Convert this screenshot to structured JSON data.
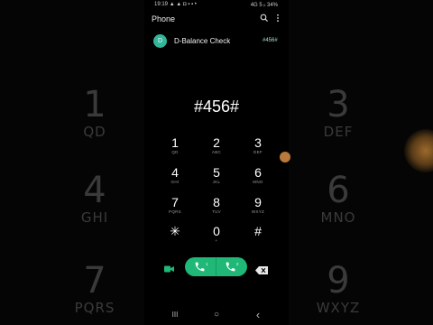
{
  "status_bar": {
    "time": "19:19",
    "left_icons": "▲ ▲ ◘ ▪ ▪ •",
    "right_info": "4G 5 ᵢₗ 34%"
  },
  "app_bar": {
    "title": "Phone",
    "icons": [
      "search-icon",
      "more-vert-icon"
    ]
  },
  "suggestion": {
    "avatar_letter": "D",
    "name": "D-Balance Check",
    "number": "#456#"
  },
  "dialed_number": "#456#",
  "keypad": [
    {
      "digit": "1",
      "letters": "QD"
    },
    {
      "digit": "2",
      "letters": "ABC"
    },
    {
      "digit": "3",
      "letters": "DEF"
    },
    {
      "digit": "4",
      "letters": "GHI"
    },
    {
      "digit": "5",
      "letters": "JKL"
    },
    {
      "digit": "6",
      "letters": "MNO"
    },
    {
      "digit": "7",
      "letters": "PQRS"
    },
    {
      "digit": "8",
      "letters": "TUV"
    },
    {
      "digit": "9",
      "letters": "WXYZ"
    },
    {
      "digit": "✳",
      "letters": ""
    },
    {
      "digit": "0",
      "letters": "+"
    },
    {
      "digit": "#",
      "letters": ""
    }
  ],
  "call_bar": {
    "sim1": "1",
    "sim2": "2",
    "color": "#1fb876"
  },
  "bg_left": [
    {
      "digit": "1",
      "letters": "QD"
    },
    {
      "digit": "4",
      "letters": "GHI"
    },
    {
      "digit": "7",
      "letters": "PQRS"
    }
  ],
  "bg_right": [
    {
      "digit": "3",
      "letters": "DEF"
    },
    {
      "digit": "6",
      "letters": "MNO"
    },
    {
      "digit": "9",
      "letters": "WXYZ"
    }
  ],
  "nav_bar": {
    "recents": "III",
    "home": "○",
    "back": "‹"
  }
}
